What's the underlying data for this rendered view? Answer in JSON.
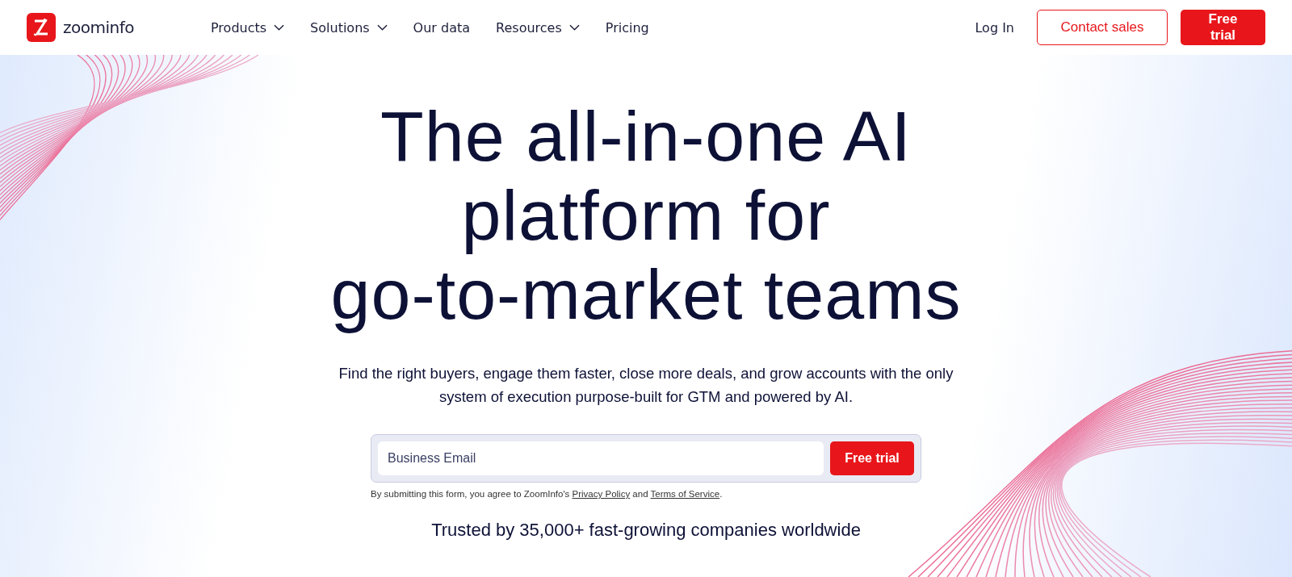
{
  "header": {
    "logo": {
      "wordmark": "zoominfo"
    },
    "nav": [
      {
        "label": "Products",
        "kind": "menu"
      },
      {
        "label": "Solutions",
        "kind": "menu"
      },
      {
        "label": "Our data",
        "kind": "link"
      },
      {
        "label": "Resources",
        "kind": "menu"
      },
      {
        "label": "Pricing",
        "kind": "link"
      }
    ],
    "actions": [
      {
        "label": "Log In",
        "kind": "text"
      },
      {
        "label": "Contact sales",
        "kind": "outline"
      },
      {
        "label": "Free trial",
        "kind": "primary"
      }
    ]
  },
  "hero": {
    "headline_lines": [
      "The all-in-one AI",
      "platform for",
      "go-to-market teams"
    ],
    "subtitle": "Find the right buyers, engage them faster, close more deals, and grow accounts with the only system of execution purpose-built for GTM and powered by AI.",
    "form": {
      "placeholder": "Business Email",
      "button": "Free trial"
    },
    "consent": [
      {
        "text": "By submitting this form, you agree to ZoomInfo's ",
        "kind": "text"
      },
      {
        "text": "Privacy Policy",
        "kind": "link"
      },
      {
        "text": " and ",
        "kind": "text"
      },
      {
        "text": "Terms of Service",
        "kind": "link"
      },
      {
        "text": ".",
        "kind": "text"
      }
    ],
    "trusted": "Trusted by 35,000+ fast-growing companies worldwide"
  }
}
